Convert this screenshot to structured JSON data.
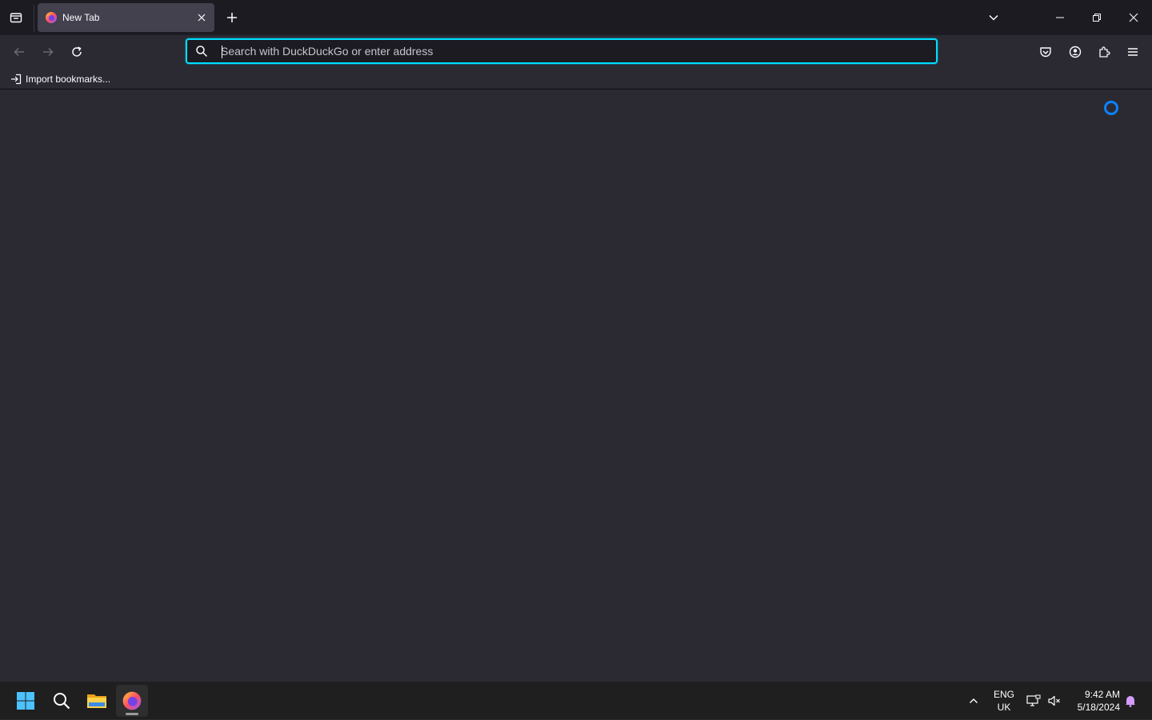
{
  "browser": {
    "tab": {
      "title": "New Tab"
    },
    "urlbar": {
      "placeholder": "Search with DuckDuckGo or enter address",
      "value": ""
    },
    "bookmarks_toolbar": {
      "import_label": "Import bookmarks..."
    }
  },
  "icons": {
    "firefox_tab": "firefox-icon",
    "search": "search-icon",
    "reload": "reload-icon",
    "pocket": "pocket-icon",
    "account": "account-icon",
    "extensions": "extensions-icon",
    "menu": "hamburger-menu-icon"
  },
  "colors": {
    "accent": "#00ddff",
    "spinner": "#0a84ff",
    "chrome_dark": "#1c1b22",
    "content_bg": "#2b2a33"
  },
  "taskbar": {
    "language": {
      "line1": "ENG",
      "line2": "UK"
    },
    "clock": {
      "time": "9:42 AM",
      "date": "5/18/2024"
    }
  }
}
